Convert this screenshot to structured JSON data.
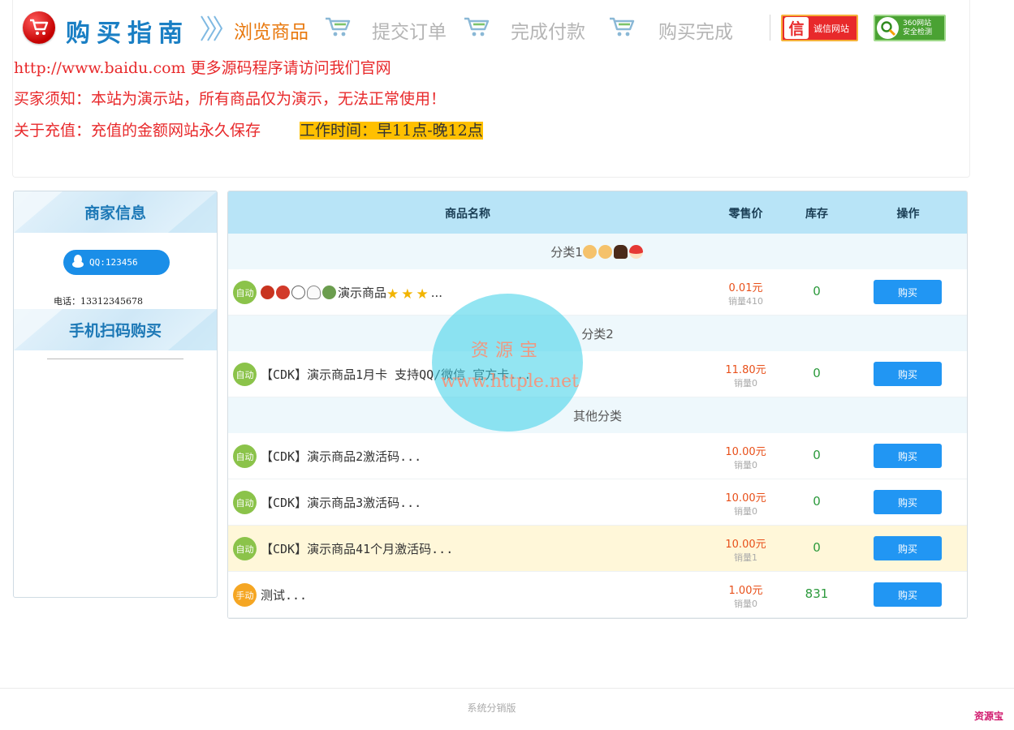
{
  "header": {
    "guide_title": "购买指南",
    "steps": [
      {
        "label": "浏览商品",
        "state": "active"
      },
      {
        "label": "提交订单",
        "state": "inactive"
      },
      {
        "label": "完成付款",
        "state": "inactive"
      },
      {
        "label": "购买完成",
        "state": "inactive"
      }
    ],
    "badges": {
      "trust_icon_text": "信",
      "trust_label": "诚信网站",
      "security_label_1": "360网站",
      "security_label_2": "安全检测"
    },
    "colors": {
      "active_step": "#e8780d",
      "inactive_step": "#b5b5b5",
      "title": "#1a7fc4"
    }
  },
  "notices": {
    "line1": "http://www.baidu.com  更多源码程序请访问我们官网",
    "line2": "买家须知：本站为演示站，所有商品仅为演示，无法正常使用！",
    "line3": "关于充值：充值的金额网站永久保存",
    "work_hours": "工作时间：早11点-晚12点",
    "colors": {
      "notice": "#e8292b",
      "highlight_bg": "#ffc000"
    }
  },
  "sidebar": {
    "merchant_title": "商家信息",
    "qq_label": "QQ:123456",
    "phone_label": "电话：13312345678",
    "scan_title": "手机扫码购买"
  },
  "table": {
    "columns": [
      "商品名称",
      "零售价",
      "库存",
      "操作"
    ],
    "categories": [
      {
        "label": "分类1"
      },
      {
        "label": "分类2"
      },
      {
        "label": "其他分类"
      }
    ],
    "rows": [
      {
        "type": "自动",
        "name": "演示商品",
        "name_suffix": "...",
        "price": "0.01元",
        "sales": "销量410",
        "stock": "0",
        "action": "购买",
        "highlighted": false
      },
      {
        "type": "自动",
        "name": "【CDK】演示商品1月卡 支持QQ/微信 官方卡...",
        "price": "11.80元",
        "sales": "销量0",
        "stock": "0",
        "action": "购买",
        "highlighted": false
      },
      {
        "type": "自动",
        "name": "【CDK】演示商品2激活码...",
        "price": "10.00元",
        "sales": "销量0",
        "stock": "0",
        "action": "购买",
        "highlighted": false
      },
      {
        "type": "自动",
        "name": "【CDK】演示商品3激活码...",
        "price": "10.00元",
        "sales": "销量0",
        "stock": "0",
        "action": "购买",
        "highlighted": false
      },
      {
        "type": "自动",
        "name": "【CDK】演示商品41个月激活码...",
        "price": "10.00元",
        "sales": "销量1",
        "stock": "0",
        "action": "购买",
        "highlighted": true
      },
      {
        "type": "手动",
        "name": "测试...",
        "price": "1.00元",
        "sales": "销量0",
        "stock": "831",
        "action": "购买",
        "highlighted": false
      }
    ],
    "colors": {
      "header_bg": "#b8e4f7",
      "category_bg": "#eef8fc",
      "price": "#e8501a",
      "stock": "#2c9a3c",
      "button": "#2196f3",
      "auto_badge": "#8bc34a",
      "manual_badge": "#f5a623",
      "highlight_row": "#fff7d9"
    }
  },
  "watermark": {
    "line1": "资源宝",
    "line2": "www.httple.net"
  },
  "footer": {
    "text": "系统分销版",
    "corner_mark": "资源宝"
  }
}
